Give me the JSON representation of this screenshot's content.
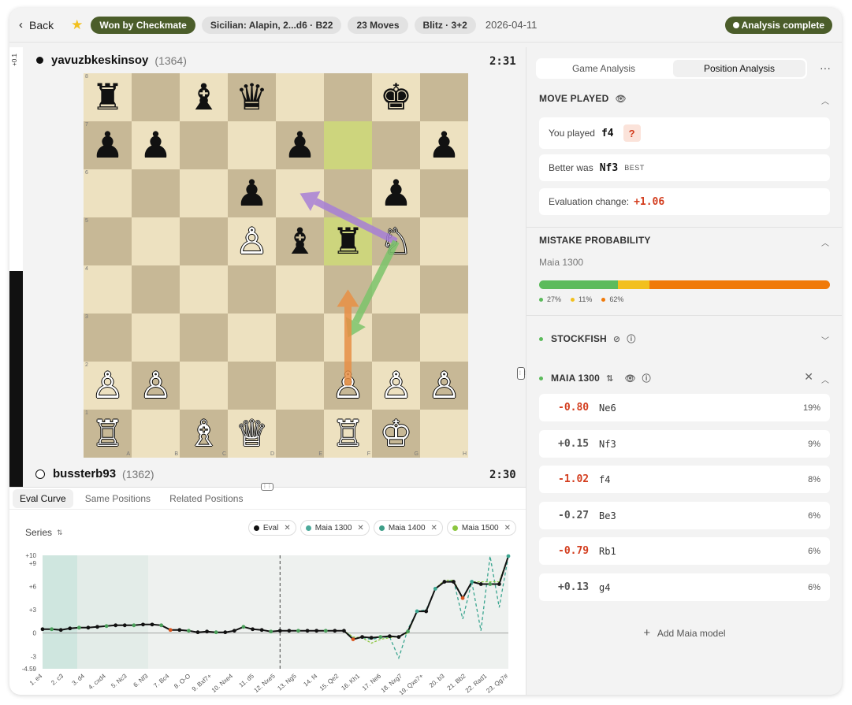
{
  "header": {
    "back_label": "Back",
    "result_label": "Won by Checkmate",
    "opening_label": "Sicilian: Alapin, 2...d6 · B22",
    "moves_label": "23 Moves",
    "time_control_label": "Blitz · 3+2",
    "date": "2026-04-11",
    "status_label": "Analysis complete",
    "accent_color": "#4b5d2a"
  },
  "eval_bar": {
    "label": "+0.1"
  },
  "top_player": {
    "name": "yavuzbkeskinsoy",
    "rating": "(1364)",
    "clock": "2:31"
  },
  "bottom_player": {
    "name": "bussterb93",
    "rating": "(1362)",
    "clock": "2:30"
  },
  "board": {
    "ranks": [
      "8",
      "7",
      "6",
      "5",
      "4",
      "3",
      "2",
      "1"
    ],
    "files": [
      "A",
      "B",
      "C",
      "D",
      "E",
      "F",
      "G",
      "H"
    ],
    "highlight_squares": [
      "f7",
      "f5"
    ],
    "pieces": [
      {
        "sq": "a8",
        "p": "♜",
        "c": "b"
      },
      {
        "sq": "c8",
        "p": "♝",
        "c": "b"
      },
      {
        "sq": "d8",
        "p": "♛",
        "c": "b"
      },
      {
        "sq": "g8",
        "p": "♚",
        "c": "b"
      },
      {
        "sq": "a7",
        "p": "♟",
        "c": "b"
      },
      {
        "sq": "b7",
        "p": "♟",
        "c": "b"
      },
      {
        "sq": "e7",
        "p": "♟",
        "c": "b"
      },
      {
        "sq": "h7",
        "p": "♟",
        "c": "b"
      },
      {
        "sq": "d6",
        "p": "♟",
        "c": "b"
      },
      {
        "sq": "g6",
        "p": "♟",
        "c": "b"
      },
      {
        "sq": "d5",
        "p": "♙",
        "c": "w"
      },
      {
        "sq": "e5",
        "p": "♝",
        "c": "b"
      },
      {
        "sq": "f5",
        "p": "♜",
        "c": "b"
      },
      {
        "sq": "g5",
        "p": "♘",
        "c": "w"
      },
      {
        "sq": "a2",
        "p": "♙",
        "c": "w"
      },
      {
        "sq": "b2",
        "p": "♙",
        "c": "w"
      },
      {
        "sq": "f2",
        "p": "♙",
        "c": "w"
      },
      {
        "sq": "g2",
        "p": "♙",
        "c": "w"
      },
      {
        "sq": "h2",
        "p": "♙",
        "c": "w"
      },
      {
        "sq": "a1",
        "p": "♖",
        "c": "w"
      },
      {
        "sq": "c1",
        "p": "♗",
        "c": "w"
      },
      {
        "sq": "d1",
        "p": "♕",
        "c": "w"
      },
      {
        "sq": "f1",
        "p": "♖",
        "c": "w"
      },
      {
        "sq": "g1",
        "p": "♔",
        "c": "w"
      }
    ],
    "arrows": [
      {
        "from": "g5",
        "to": "e6",
        "color": "#a77fd6"
      },
      {
        "from": "g5",
        "to": "f3",
        "color": "#7cc46b"
      },
      {
        "from": "f2",
        "to": "f4",
        "color": "#e88f45"
      }
    ]
  },
  "bottom_tabs": [
    "Eval Curve",
    "Same Positions",
    "Related Positions"
  ],
  "series": {
    "label": "Series",
    "chips": [
      {
        "label": "Eval",
        "color": "#111111"
      },
      {
        "label": "Maia 1300",
        "color": "#4ca99a"
      },
      {
        "label": "Maia 1400",
        "color": "#3e9e88"
      },
      {
        "label": "Maia 1500",
        "color": "#8cc63f"
      }
    ]
  },
  "chart_data": {
    "type": "line",
    "y_ticks": [
      "+10",
      "+9",
      "+6",
      "+3",
      "0",
      "-3",
      "-4.59"
    ],
    "ylim": [
      -4.59,
      10
    ],
    "x_labels": [
      "1. e4",
      "2. c3",
      "3. d4",
      "4. cxd4",
      "5. Nc3",
      "6. Nf3",
      "7. Bc4",
      "8. O-O",
      "9. Bxf7+",
      "10. Nxe4",
      "11. d5",
      "12. Nxe5",
      "13. Ng5",
      "14. f4",
      "15. Qe2",
      "16. Kh1",
      "17. Ne6",
      "18. Nxg7",
      "19. Qxe7+",
      "20. b3",
      "21. Bb2",
      "22. Rad1",
      "23. Qg7#"
    ],
    "current_index": 26,
    "series": [
      {
        "name": "Eval",
        "values": [
          0.5,
          0.5,
          0.4,
          0.6,
          0.7,
          0.7,
          0.8,
          0.9,
          1.0,
          1.0,
          1.0,
          1.1,
          1.1,
          1.0,
          0.4,
          0.4,
          0.3,
          0.1,
          0.2,
          0.1,
          0.1,
          0.3,
          0.8,
          0.5,
          0.4,
          0.2,
          0.3,
          0.3,
          0.3,
          0.3,
          0.3,
          0.3,
          0.3,
          0.3,
          -0.8,
          -0.5,
          -0.6,
          -0.5,
          -0.4,
          -0.5,
          0.2,
          2.8,
          2.8,
          5.7,
          6.6,
          6.6,
          4.5,
          6.6,
          6.3,
          6.3,
          6.3,
          9.9
        ]
      },
      {
        "name": "Maia 1500",
        "values": [
          0.5,
          0.5,
          0.4,
          0.6,
          0.7,
          0.7,
          0.8,
          0.9,
          1.0,
          1.0,
          1.0,
          1.1,
          1.1,
          1.0,
          0.4,
          0.4,
          0.3,
          0.1,
          0.2,
          0.1,
          0.1,
          0.3,
          0.8,
          0.5,
          0.4,
          0.2,
          0.3,
          0.3,
          0.3,
          0.3,
          0.3,
          0.3,
          0.3,
          0.3,
          -0.5,
          -0.6,
          -1.3,
          -0.8,
          -0.6,
          -0.4,
          0.0,
          2.8,
          2.8,
          5.7,
          6.8,
          6.8,
          4.5,
          6.6,
          6.6,
          6.6,
          6.6,
          9.9
        ]
      },
      {
        "name": "Maia 1300",
        "values": [
          0.5,
          0.5,
          0.4,
          0.6,
          0.7,
          0.7,
          0.8,
          0.9,
          1.0,
          1.0,
          1.0,
          1.1,
          1.1,
          1.0,
          0.4,
          0.4,
          0.3,
          0.1,
          0.2,
          0.1,
          0.1,
          0.3,
          0.8,
          0.5,
          0.4,
          0.2,
          0.3,
          0.3,
          0.3,
          0.3,
          0.3,
          0.3,
          0.3,
          0.3,
          -0.6,
          -0.6,
          -0.8,
          -0.6,
          -0.5,
          -3.2,
          0.5,
          2.8,
          3.0,
          5.7,
          6.6,
          6.8,
          1.8,
          6.6,
          0.3,
          9.9,
          3.3,
          9.9
        ]
      }
    ]
  },
  "right": {
    "tabs": [
      "Game Analysis",
      "Position Analysis"
    ],
    "more_label": "···",
    "move_played": {
      "title": "MOVE PLAYED",
      "you_played_label": "You played",
      "you_played_move": "f4",
      "mistake_badge": "?",
      "better_label": "Better was",
      "better_move": "Nf3",
      "best_tag": "BEST",
      "eval_change_label": "Evaluation change:",
      "eval_change_value": "+1.06"
    },
    "mistake_probability": {
      "title": "MISTAKE PROBABILITY",
      "model": "Maia 1300",
      "segments": [
        {
          "label": "27%",
          "value": 27,
          "color": "#5cbb5c"
        },
        {
          "label": "11%",
          "value": 11,
          "color": "#f2c01e"
        },
        {
          "label": "62%",
          "value": 62,
          "color": "#f07a0a"
        }
      ]
    },
    "stockfish_title": "STOCKFISH",
    "maia_title": "MAIA 1300",
    "maia_moves": [
      {
        "eval": "-0.80",
        "move": "Ne6",
        "pct": "19%",
        "neg": true
      },
      {
        "eval": "+0.15",
        "move": "Nf3",
        "pct": "9%",
        "neg": false
      },
      {
        "eval": "-1.02",
        "move": "f4",
        "pct": "8%",
        "neg": true
      },
      {
        "eval": "-0.27",
        "move": "Be3",
        "pct": "6%",
        "neg": false
      },
      {
        "eval": "-0.79",
        "move": "Rb1",
        "pct": "6%",
        "neg": true
      },
      {
        "eval": "+0.13",
        "move": "g4",
        "pct": "6%",
        "neg": false
      }
    ],
    "add_maia_label": "Add Maia model"
  }
}
